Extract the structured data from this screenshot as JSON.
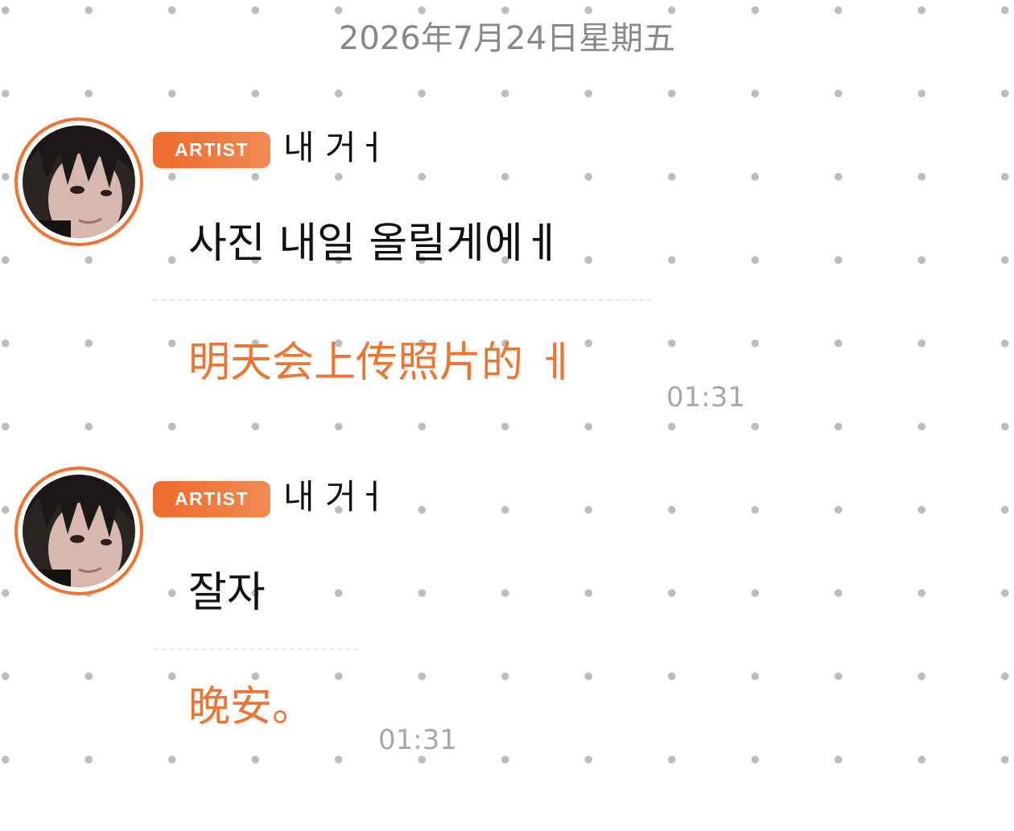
{
  "date_header": "2026年7月24日星期五",
  "colors": {
    "accent": "#ee7433",
    "dots": "#bdbdbd",
    "timestamp": "#a8a8a8"
  },
  "messages": [
    {
      "badge": "ARTIST",
      "sender": "내 거ㅓ",
      "text_ko": "사진 내일 올릴게에ㅔ",
      "text_zh": "明天会上传照片的 ㅔ",
      "time": "01:31",
      "avatar_icon": "artist-avatar"
    },
    {
      "badge": "ARTIST",
      "sender": "내 거ㅓ",
      "text_ko": "잘자",
      "text_zh": "晚安。",
      "time": "01:31",
      "avatar_icon": "artist-avatar"
    }
  ]
}
